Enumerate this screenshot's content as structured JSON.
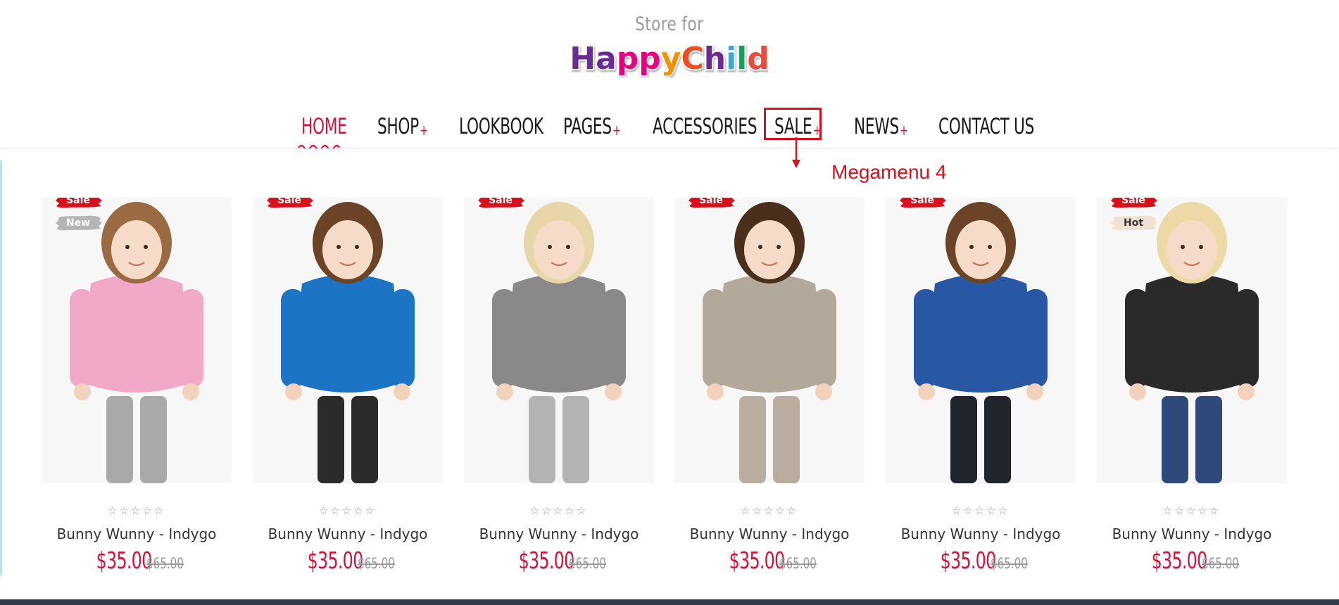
{
  "logo": {
    "tagline": "Store for",
    "wordmark": "HappyChild",
    "letter_colors": [
      "#6a2c91",
      "#6a2c91",
      "#e6007e",
      "#e6007e",
      "#f39200",
      "#ea4f28",
      "#6a2c91",
      "#39a9dc",
      "#1a9c5a",
      "#ec4a3c"
    ]
  },
  "nav": {
    "items": [
      {
        "label": "HOME",
        "has_submenu": false,
        "active": true
      },
      {
        "label": "SHOP",
        "has_submenu": true,
        "active": false
      },
      {
        "label": "LOOKBOOK",
        "has_submenu": false,
        "active": false
      },
      {
        "label": "PAGES",
        "has_submenu": true,
        "active": false
      },
      {
        "label": "ACCESSORIES",
        "has_submenu": false,
        "active": false
      },
      {
        "label": "SALE",
        "has_submenu": true,
        "active": false
      },
      {
        "label": "NEWS",
        "has_submenu": true,
        "active": false
      },
      {
        "label": "CONTACT US",
        "has_submenu": false,
        "active": false
      }
    ],
    "plus": "+"
  },
  "annotation": {
    "label": "Megamenu 4",
    "color": "#d8101c"
  },
  "colors": {
    "accent": "#d4123a",
    "bottom_bar": "#2f3e4a"
  },
  "products": [
    {
      "name": "Bunny Wunny - Indygo",
      "price": "$35.00",
      "old_price": "$65.00",
      "rating": "☆☆☆☆☆",
      "badges": [
        "Sale",
        "New"
      ],
      "garment": "pink quilted jacket",
      "top_color": "#f2a9c7",
      "bottom_color": "#a9a9a9",
      "hair_color": "#9a6b43"
    },
    {
      "name": "Bunny Wunny - Indygo",
      "price": "$35.00",
      "old_price": "$65.00",
      "rating": "☆☆☆☆☆",
      "badges": [
        "Sale"
      ],
      "garment": "minion fleece jacket",
      "top_color": "#1e74c4",
      "bottom_color": "#2b2b2b",
      "hair_color": "#6b4428"
    },
    {
      "name": "Bunny Wunny - Indygo",
      "price": "$35.00",
      "old_price": "$65.00",
      "rating": "☆☆☆☆☆",
      "badges": [
        "Sale"
      ],
      "garment": "grey knit hoodie",
      "top_color": "#8a8888",
      "bottom_color": "#b3b3b3",
      "hair_color": "#e8d5a8"
    },
    {
      "name": "Bunny Wunny - Indygo",
      "price": "$35.00",
      "old_price": "$65.00",
      "rating": "☆☆☆☆☆",
      "badges": [
        "Sale"
      ],
      "garment": "beige suit with bow tie",
      "top_color": "#b3a99a",
      "bottom_color": "#b8ad9e",
      "hair_color": "#4a2f1d"
    },
    {
      "name": "Bunny Wunny - Indygo",
      "price": "$35.00",
      "old_price": "$65.00",
      "rating": "☆☆☆☆☆",
      "badges": [
        "Sale"
      ],
      "garment": "blue sweatshirt",
      "top_color": "#2858a4",
      "bottom_color": "#23252e",
      "hair_color": "#6b4428"
    },
    {
      "name": "Bunny Wunny - Indygo",
      "price": "$35.00",
      "old_price": "$65.00",
      "rating": "☆☆☆☆☆",
      "badges": [
        "Sale",
        "Hot"
      ],
      "garment": "black leather jacket",
      "top_color": "#2a2a2a",
      "bottom_color": "#2e4a7a",
      "hair_color": "#ecd9a6"
    }
  ]
}
